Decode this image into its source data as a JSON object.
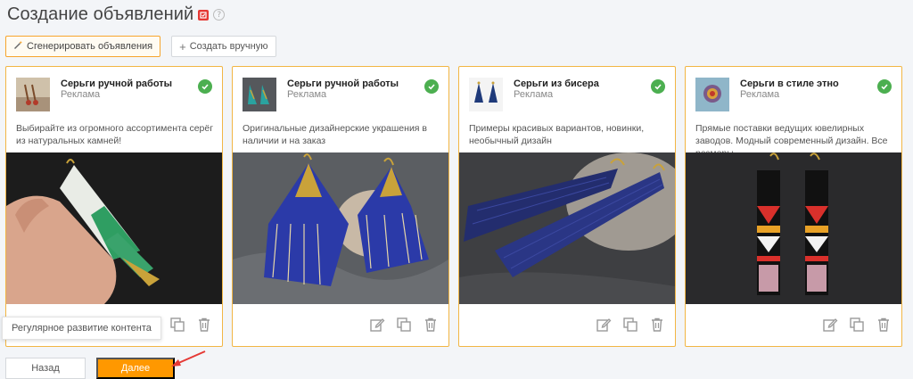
{
  "page": {
    "title": "Создание объявлений",
    "help_glyph": "?"
  },
  "toolbar": {
    "generate_label": "Сгенерировать объявления",
    "manual_label": "Создать вручную",
    "manual_icon_glyph": "+"
  },
  "cards": [
    {
      "title": "Серьги ручной работы",
      "subtitle": "Реклама",
      "description": "Выбирайте из огромного ассортимента серёг из натуральных камней!",
      "status": "approved"
    },
    {
      "title": "Серьги ручной работы",
      "subtitle": "Реклама",
      "description": "Оригинальные дизайнерские украшения в наличии и на заказ",
      "status": "approved"
    },
    {
      "title": "Серьги из бисера",
      "subtitle": "Реклама",
      "description": "Примеры красивых вариантов, новинки, необычный дизайн",
      "status": "approved"
    },
    {
      "title": "Серьги в стиле этно",
      "subtitle": "Реклама",
      "description": "Прямые поставки ведущих ювелирных заводов. Модный современный дизайн. Все размеры",
      "status": "approved"
    }
  ],
  "tooltip": {
    "text": "Регулярное развитие контента"
  },
  "footer": {
    "back_label": "Назад",
    "next_label": "Далее"
  },
  "colors": {
    "accent": "#ff9800",
    "card_border": "#f2b644",
    "check": "#4caf50",
    "brand_badge": "#e53935",
    "annotation_arrow": "#e53935"
  }
}
